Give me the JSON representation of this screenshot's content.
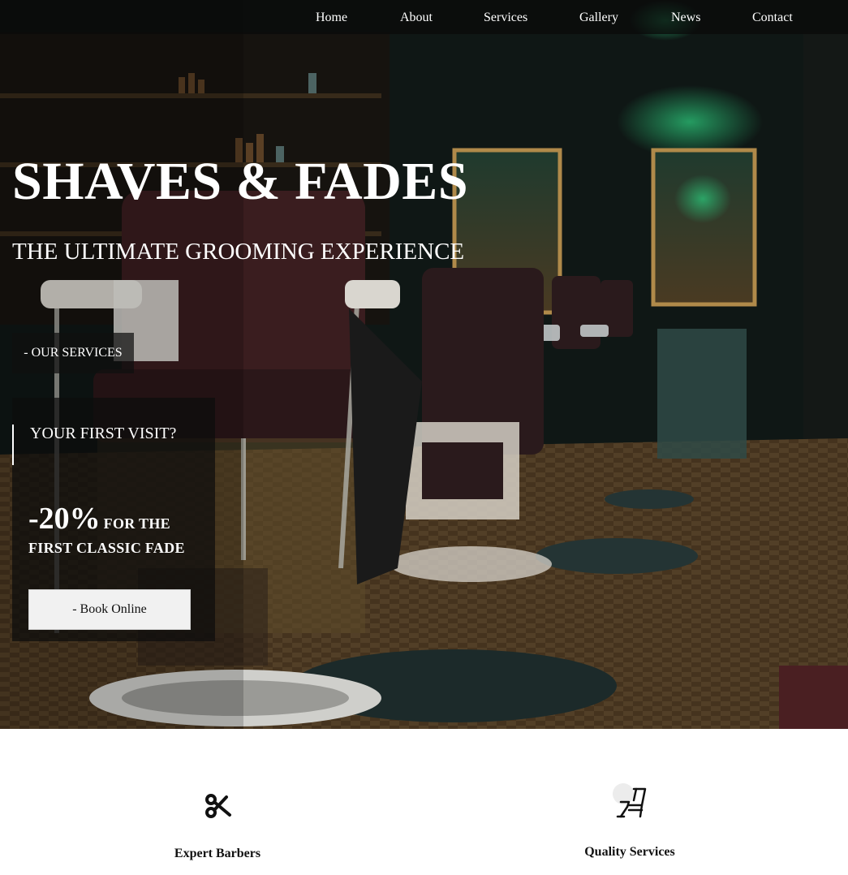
{
  "nav": {
    "items": [
      {
        "label": "Home"
      },
      {
        "label": "About"
      },
      {
        "label": "Services"
      },
      {
        "label": "Gallery"
      },
      {
        "label": "News"
      },
      {
        "label": "Contact"
      }
    ]
  },
  "hero": {
    "title": "SHAVES & FADES",
    "subtitle": "THE ULTIMATE GROOMING EXPERIENCE",
    "services_button": "- OUR SERVICES"
  },
  "promo": {
    "heading": "YOUR FIRST VISIT?",
    "percent": "-20%",
    "line1": "FOR THE",
    "line2": "FIRST CLASSIC FADE",
    "book_button": "- Book Online"
  },
  "features": [
    {
      "label": "Expert Barbers",
      "icon": "scissors-icon"
    },
    {
      "label": "Quality Services",
      "icon": "barber-chair-icon"
    }
  ],
  "colors": {
    "nav_background": "#0a0a0a",
    "panel_background": "#0c0c0c",
    "button_background": "#f1f1f1",
    "text_light": "#ffffff",
    "text_dark": "#111111"
  }
}
